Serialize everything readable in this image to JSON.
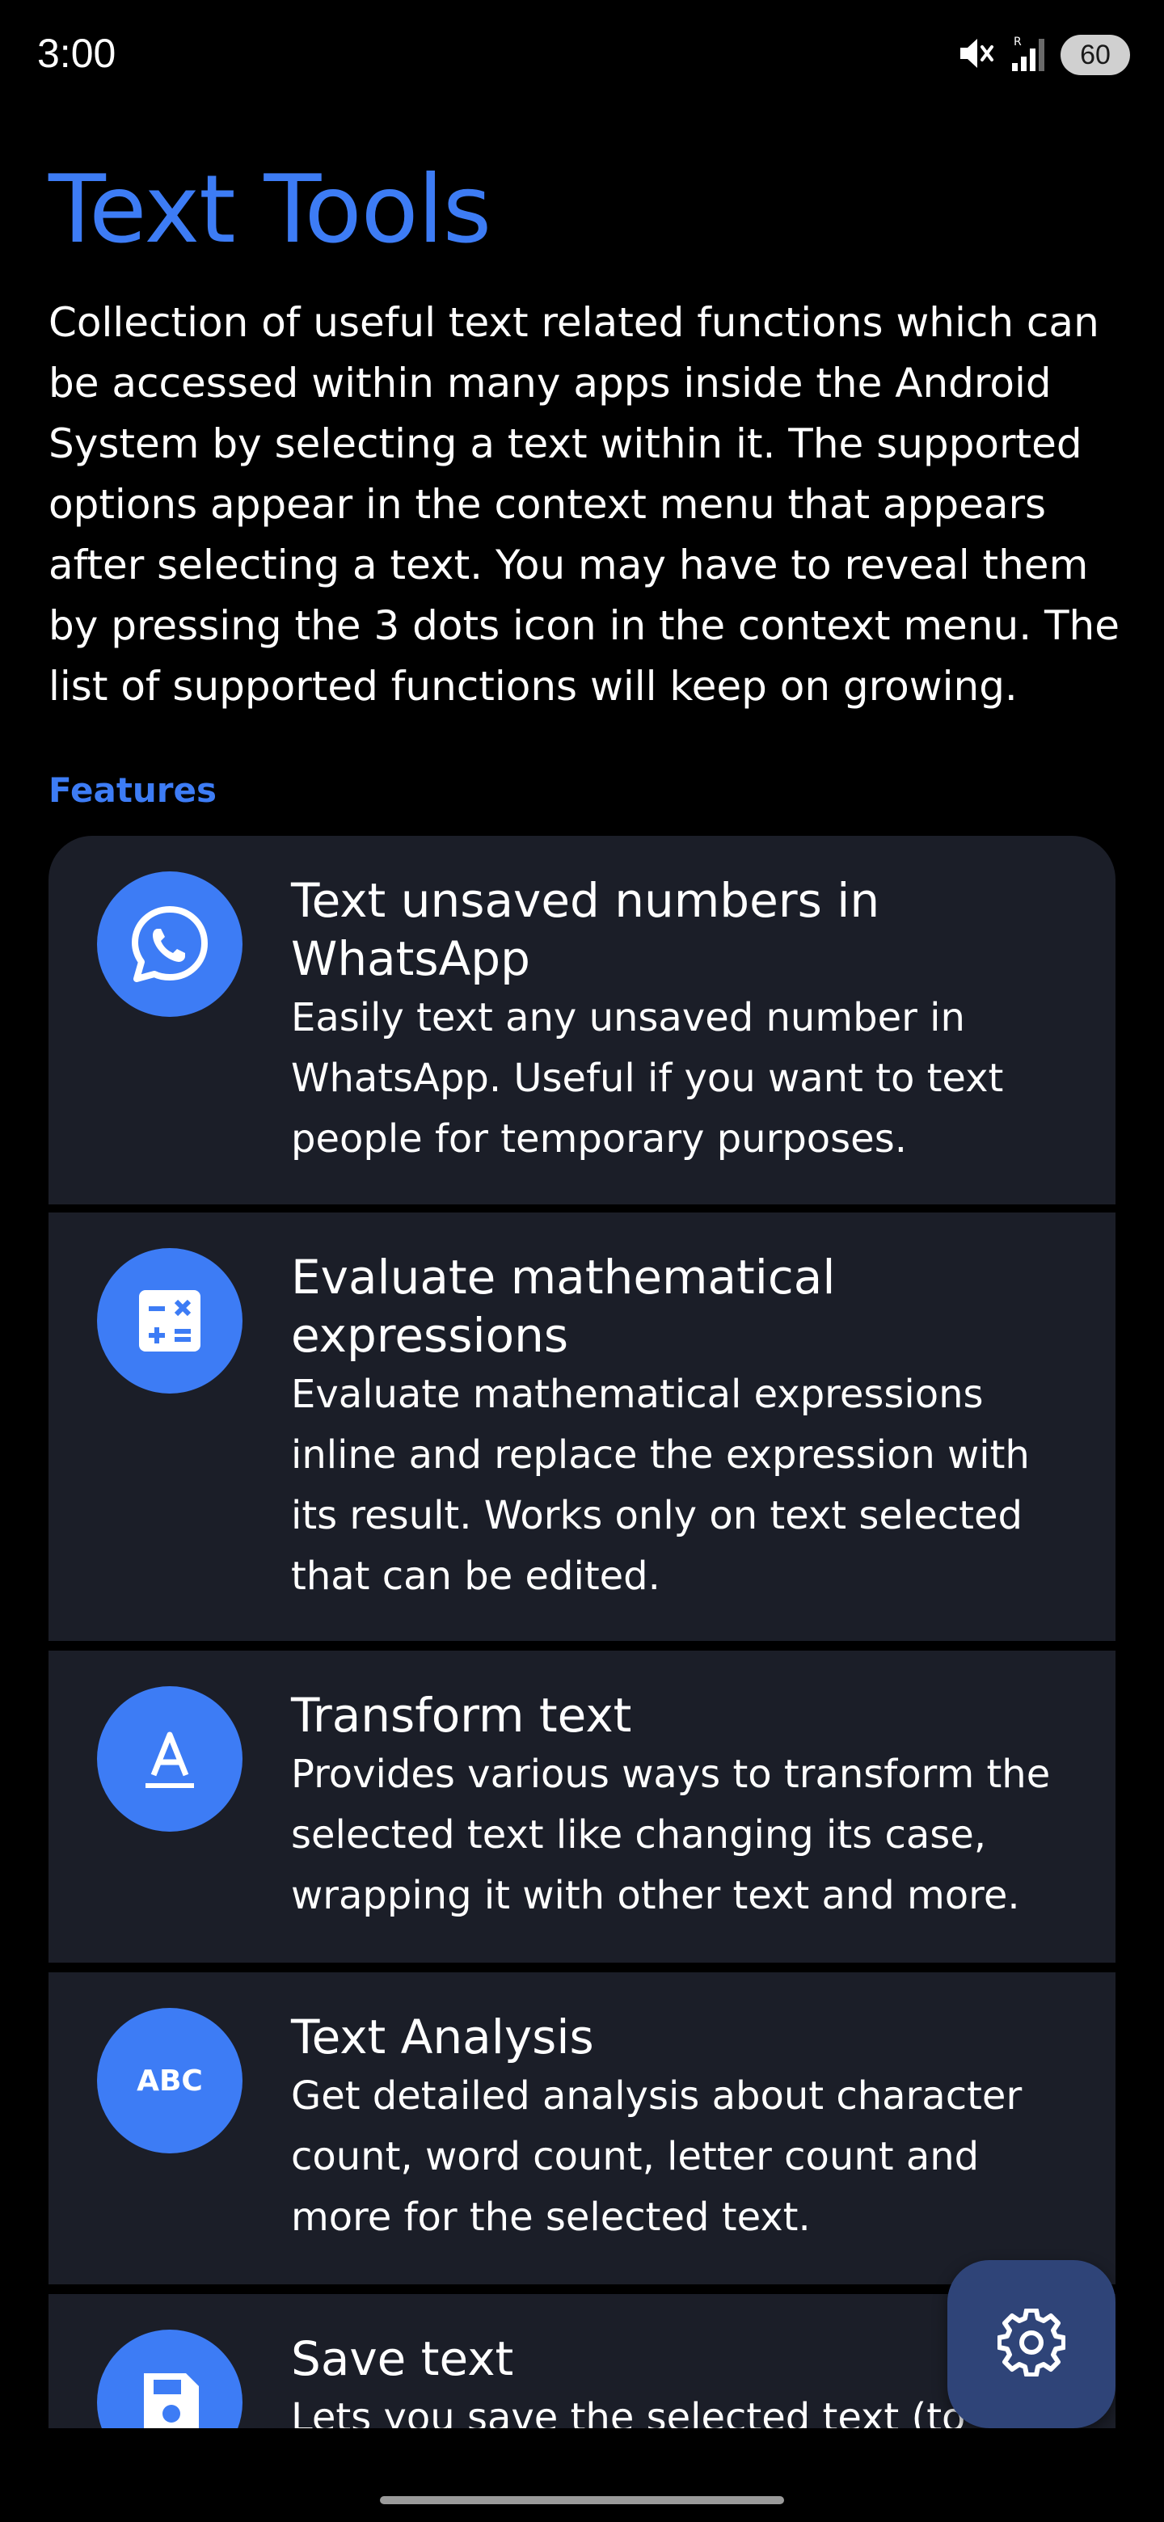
{
  "status_bar": {
    "time": "3:00",
    "battery_level": "60",
    "icons": [
      "mute-icon",
      "signal-icon",
      "battery-icon"
    ]
  },
  "page": {
    "title": "Text Tools",
    "description": "Collection of useful text related functions which can be accessed within many apps inside the Android System by selecting a text within it. The supported options appear in the context menu that appears after selecting a text. You may have to reveal them by pressing the 3 dots icon in the context menu. The list of supported functions will keep on growing.",
    "section_label": "Features"
  },
  "features": [
    {
      "icon": "whatsapp-icon",
      "title": "Text unsaved numbers in WhatsApp",
      "description": "Easily text any unsaved number in WhatsApp. Useful if you want to text people for temporary purposes."
    },
    {
      "icon": "calculator-icon",
      "title": "Evaluate mathematical expressions",
      "description": "Evaluate mathematical expressions inline and replace the expression with its result. Works only on text selected that can be edited."
    },
    {
      "icon": "text-format-icon",
      "title": "Transform text",
      "description": "Provides various ways to transform the selected text like changing its case, wrapping it with other text and more."
    },
    {
      "icon": "abc-icon",
      "title": "Text Analysis",
      "description": "Get detailed analysis about character count, word count, letter count and more for the selected text."
    },
    {
      "icon": "save-icon",
      "title": "Save text",
      "description": "Lets you save the selected text (to"
    }
  ],
  "fab": {
    "icon": "settings-gear-icon"
  },
  "colors": {
    "accent": "#3d7cf5",
    "card_background": "#1b1e28",
    "fab_background": "#2f4478",
    "background": "#000000"
  }
}
